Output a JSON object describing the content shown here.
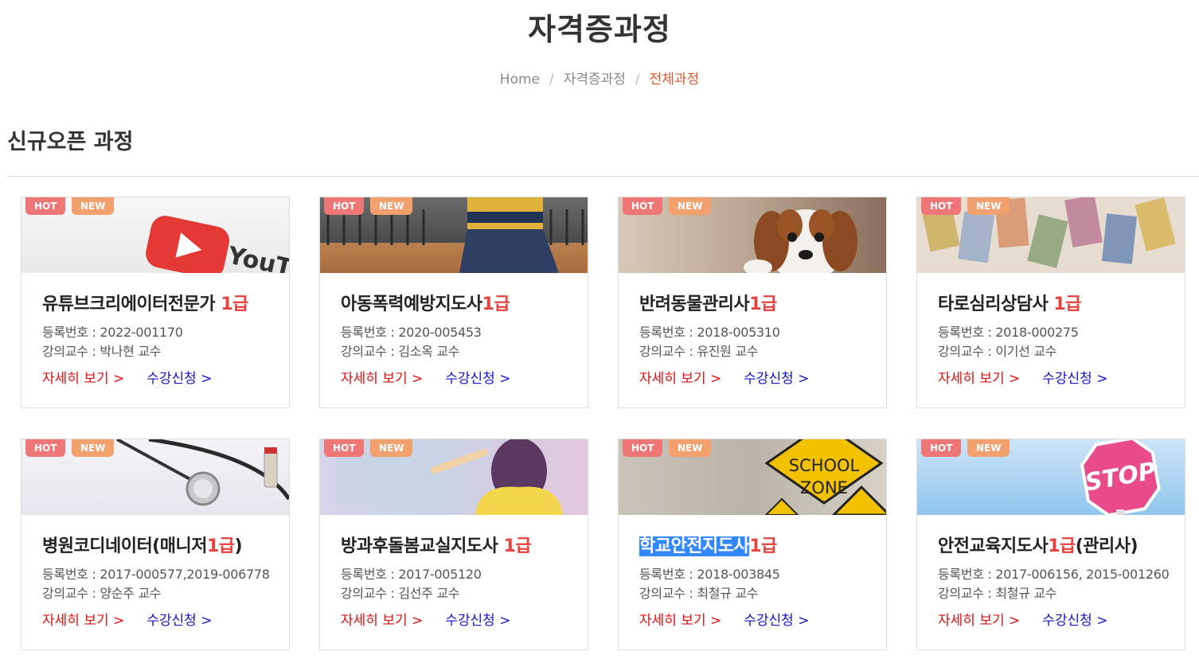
{
  "header": {
    "title": "자격증과정",
    "breadcrumb": {
      "home": "Home",
      "separator": "/",
      "level1": "자격증과정",
      "current": "전체과정"
    }
  },
  "section": {
    "title": "신규오픈 과정"
  },
  "labels": {
    "hot": "HOT",
    "new": "NEW",
    "reg_prefix": "등록번호 : ",
    "prof_prefix": "강의교수 : ",
    "detail_link": "자세히 보기 >",
    "apply_link": "수강신청 >"
  },
  "colors": {
    "accent": "#e4572e",
    "grade": "#e8423f",
    "detail_link": "#e01010",
    "apply_link": "#1414cc",
    "tag_hot": "#ef7676",
    "tag_new": "#f3a06f",
    "selection": "#3388ff"
  },
  "courses": [
    {
      "title_main": "유튜브크리에이터전문가 ",
      "title_grade": "1급",
      "title_suffix": "",
      "selected": false,
      "reg_no": "2022-001170",
      "professor": "박나현 교수",
      "image": "youtube-logo"
    },
    {
      "title_main": "아동폭력예방지도사",
      "title_grade": "1급",
      "title_suffix": "",
      "selected": false,
      "reg_no": "2020-005453",
      "professor": "김소옥 교수",
      "image": "child-sitting"
    },
    {
      "title_main": "반려동물관리사",
      "title_grade": "1급",
      "title_suffix": "",
      "selected": false,
      "reg_no": "2018-005310",
      "professor": "유진원 교수",
      "image": "puppy"
    },
    {
      "title_main": "타로심리상담사 ",
      "title_grade": "1급",
      "title_suffix": "",
      "selected": false,
      "reg_no": "2018-000275",
      "professor": "이기선 교수",
      "image": "tarot-cards"
    },
    {
      "title_main": "병원코디네이터(매니저",
      "title_grade": "1급",
      "title_suffix": ")",
      "selected": false,
      "reg_no": "2017-000577,2019-006778",
      "professor": "양순주 교수",
      "image": "stethoscope"
    },
    {
      "title_main": "방과후돌봄교실지도사 ",
      "title_grade": "1급",
      "title_suffix": "",
      "selected": false,
      "reg_no": "2017-005120",
      "professor": "김선주 교수",
      "image": "girl-classroom"
    },
    {
      "title_main": "학교안전지도사",
      "title_grade": "1급",
      "title_suffix": "",
      "selected": true,
      "reg_no": "2018-003845",
      "professor": "최철규 교수",
      "image": "school-zone-sign",
      "sign_text_1": "SCHOOL",
      "sign_text_2": "ZONE"
    },
    {
      "title_main": "안전교육지도사",
      "title_grade": "1급",
      "title_suffix": "(관리사)",
      "selected": false,
      "reg_no": "2017-006156, 2015-001260",
      "professor": "최철규 교수",
      "image": "stop-sign",
      "sign_text_1": "STOP"
    }
  ]
}
